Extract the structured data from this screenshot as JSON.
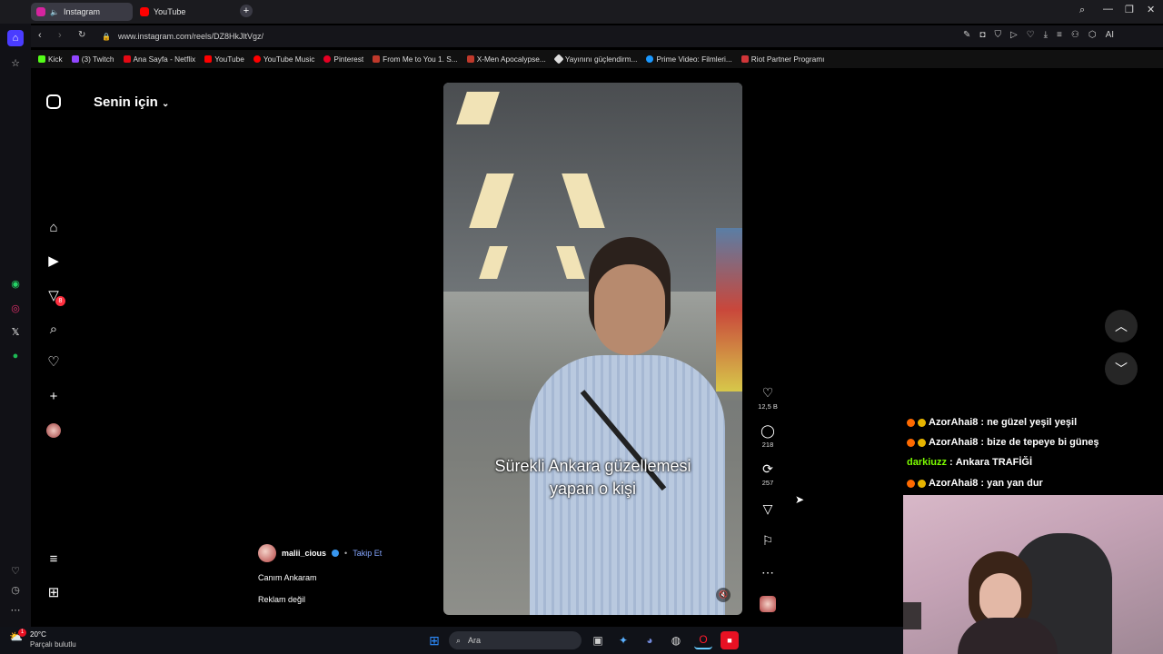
{
  "tabs": [
    {
      "label": "Instagram",
      "color": "#d6249f"
    },
    {
      "label": "YouTube",
      "color": "#ff0000"
    }
  ],
  "address": {
    "url": "www.instagram.com/reels/DZ8HkJltVgz/"
  },
  "bookmarks": [
    {
      "label": "Kick",
      "color": "#53fc18"
    },
    {
      "label": "(3) Twitch",
      "color": "#9146ff"
    },
    {
      "label": "Ana Sayfa - Netflix",
      "color": "#e50914"
    },
    {
      "label": "YouTube",
      "color": "#ff0000"
    },
    {
      "label": "YouTube Music",
      "color": "#ff0000"
    },
    {
      "label": "Pinterest",
      "color": "#e60023"
    },
    {
      "label": "From Me to You 1. S...",
      "color": "#c0392b"
    },
    {
      "label": "X-Men Apocalypse...",
      "color": "#c0392b"
    },
    {
      "label": "Yayınını güçlendirm...",
      "color": "#dddddd"
    },
    {
      "label": "Prime Video: Filmleri...",
      "color": "#1a98ff"
    },
    {
      "label": "Riot Partner Programı",
      "color": "#d13639"
    }
  ],
  "feed": {
    "title": "Senin için"
  },
  "nav": {
    "notifications_badge": "8"
  },
  "video": {
    "caption_line1": "Sürekli Ankara güzellemesi",
    "caption_line2": "yapan o kişi"
  },
  "actions": {
    "likes": "12,5 B",
    "comments": "218",
    "reposts": "257"
  },
  "post": {
    "username": "malii_cious",
    "follow_label": "Takip Et",
    "audio": "Canım Ankaram",
    "ad_label": "Reklam değil"
  },
  "chat": [
    {
      "user": "AzorAhai8",
      "message": "ne güzel yeşil yeşil",
      "user_color": "#ffffff"
    },
    {
      "user": "AzorAhai8",
      "message": "bize de tepeye bi güneş",
      "user_color": "#ffffff"
    },
    {
      "user": "darkiuzz",
      "message": "Ankara TRAFİĞİ",
      "user_color": "#7CFC00"
    },
    {
      "user": "AzorAhai8",
      "message": "yan yan dur",
      "user_color": "#ffffff"
    }
  ],
  "taskbar": {
    "temperature": "20°C",
    "weather": "Parçalı bulutlu",
    "search_placeholder": "Ara",
    "weather_badge": "1"
  }
}
